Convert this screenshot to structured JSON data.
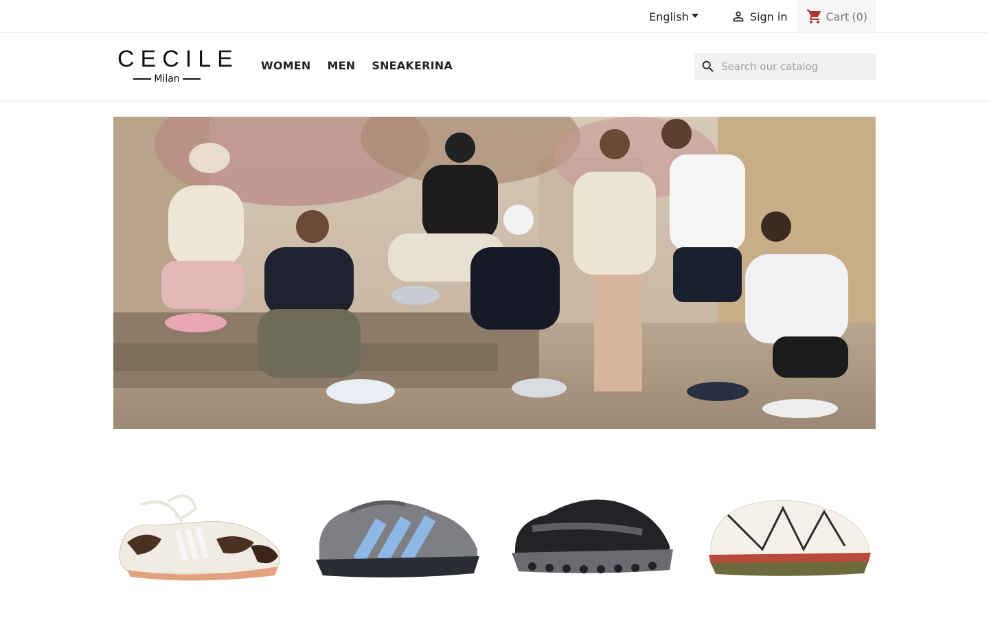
{
  "topbar": {
    "language": "English",
    "signin_label": "Sign in",
    "cart_label": "Cart",
    "cart_count": "(0)"
  },
  "header": {
    "logo_main": "CECILE",
    "logo_sub": "Milan",
    "menu": [
      {
        "label": "WOMEN"
      },
      {
        "label": "MEN"
      },
      {
        "label": "SNEAKERINA"
      }
    ],
    "search_placeholder": "Search our catalog"
  },
  "hero": {
    "image": "group-of-friends-wearing-sneakers-photo"
  },
  "products": [
    {
      "image": "lace-up-ballet-sneaker-cow-print"
    },
    {
      "image": "grey-running-shoe-blue-stripes"
    },
    {
      "image": "black-grey-running-shoe"
    },
    {
      "image": "white-trail-sneaker"
    }
  ],
  "colors": {
    "text": "#232323",
    "muted": "#7a7a7a",
    "search_bg": "#f1f1f1",
    "cart_bg": "#f6f6f6"
  }
}
